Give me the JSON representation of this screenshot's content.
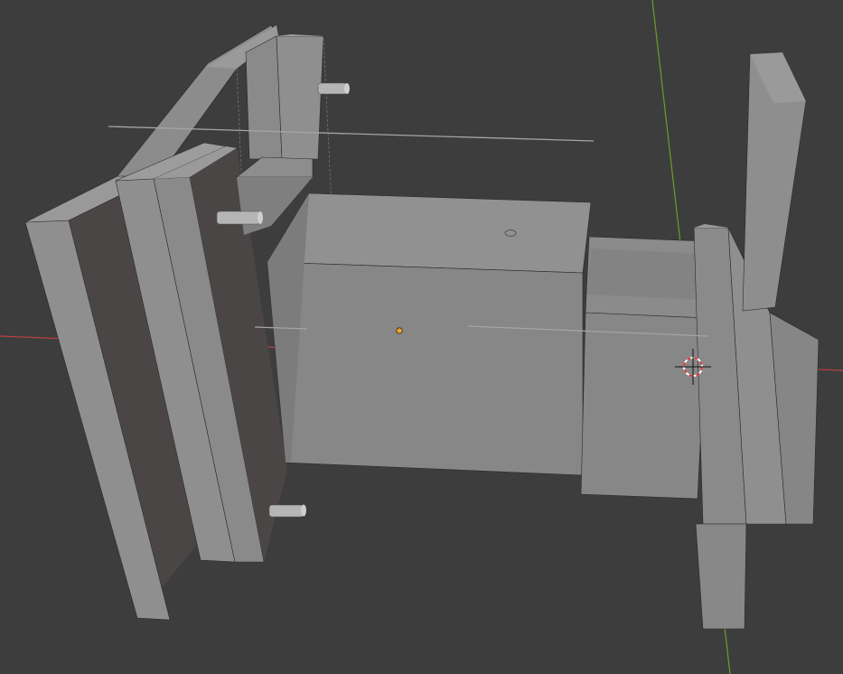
{
  "app": {
    "window_title": "",
    "editor": "3D Viewport"
  },
  "viewport": {
    "background_color": "#3d3d3d",
    "axis_x_color": "#b84040",
    "axis_y_color": "#6d9b2c",
    "face_light": "#8f8f8f",
    "face_mid": "#868686",
    "face_dark": "#4a4646",
    "edge_color": "#2a2a2a",
    "selected_origin_color": "#f5a623",
    "cursor_ring_colors": [
      "#d83a3a",
      "#ffffff"
    ]
  },
  "icons": {
    "origin": "object-origin-icon",
    "cursor": "3d-cursor-icon"
  }
}
